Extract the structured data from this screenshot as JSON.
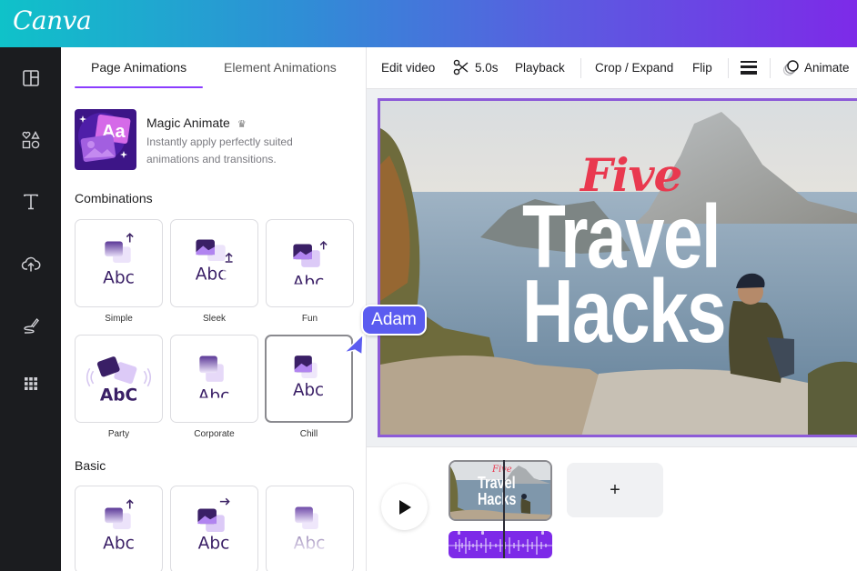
{
  "app": {
    "logo": "Canva",
    "brand_gradient": [
      "#0fc2c9",
      "#7d2ae8"
    ],
    "accent": "#8b3dff"
  },
  "rail": {
    "items": [
      {
        "name": "design",
        "icon": "layout-icon"
      },
      {
        "name": "elements",
        "icon": "shapes-icon"
      },
      {
        "name": "text",
        "icon": "text-icon"
      },
      {
        "name": "uploads",
        "icon": "cloud-upload-icon"
      },
      {
        "name": "draw",
        "icon": "draw-icon"
      },
      {
        "name": "apps",
        "icon": "apps-grid-icon"
      }
    ]
  },
  "panel": {
    "tabs": [
      {
        "label": "Page Animations",
        "active": true
      },
      {
        "label": "Element Animations",
        "active": false
      }
    ],
    "magic": {
      "title": "Magic Animate",
      "badge_icon": "crown-icon",
      "description": "Instantly apply perfectly suited animations and transitions."
    },
    "sections": [
      {
        "title": "Combinations",
        "cards": [
          {
            "label": "Simple",
            "preview": "Abc",
            "selected": false
          },
          {
            "label": "Sleek",
            "preview": "Abc",
            "selected": false
          },
          {
            "label": "Fun",
            "preview": "Abc",
            "selected": false
          },
          {
            "label": "Party",
            "preview": "AbC",
            "selected": false
          },
          {
            "label": "Corporate",
            "preview": "Abc",
            "selected": false
          },
          {
            "label": "Chill",
            "preview": "Abc",
            "selected": true
          }
        ]
      },
      {
        "title": "Basic",
        "cards": [
          {
            "label": "",
            "preview": "Abc",
            "selected": false
          },
          {
            "label": "",
            "preview": "Abc",
            "selected": false
          },
          {
            "label": "",
            "preview": "Abc",
            "selected": false
          }
        ]
      }
    ]
  },
  "toolbar": {
    "edit_video": "Edit video",
    "duration": "5.0s",
    "playback": "Playback",
    "crop_expand": "Crop / Expand",
    "flip": "Flip",
    "animate": "Animate"
  },
  "canvas": {
    "title_script": "Five",
    "title_line1": "Travel",
    "title_line2": "Hacks",
    "script_color": "#e9394f",
    "selection_color": "#8d5bd8"
  },
  "collaborator": {
    "name": "Adam",
    "color": "#5b5cf0"
  },
  "timeline": {
    "clip": {
      "title_script": "Five",
      "title_line1": "Travel",
      "title_line2": "Hacks"
    },
    "add_page_label": "+",
    "audio_color": "#7d2ae8"
  }
}
